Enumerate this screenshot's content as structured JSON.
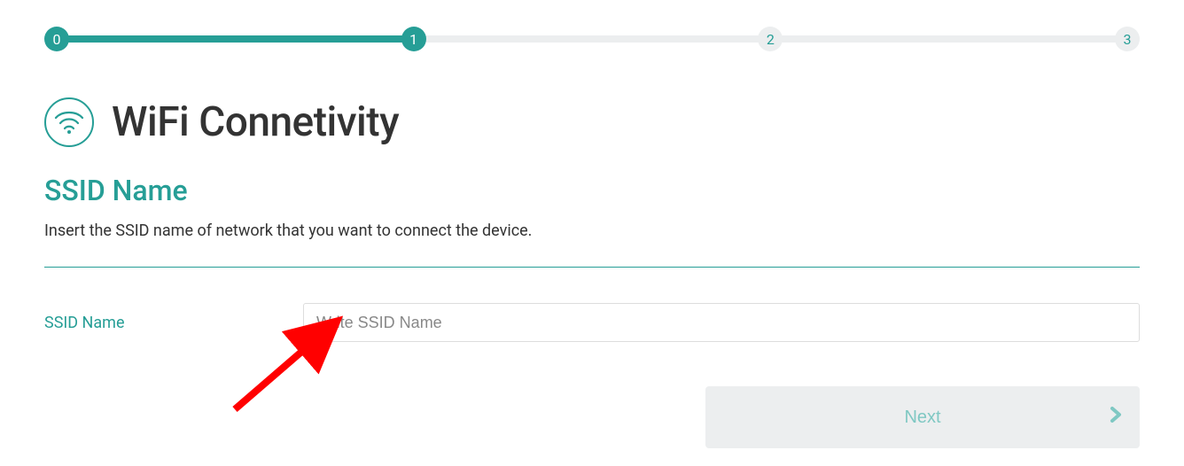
{
  "stepper": {
    "steps": [
      "0",
      "1",
      "2",
      "3"
    ],
    "current_index": 1
  },
  "page": {
    "title": "WiFi Connetivity",
    "section_title": "SSID Name",
    "subtitle": "Insert the SSID name of network that you want to connect the device."
  },
  "form": {
    "ssid_label": "SSID Name",
    "ssid_placeholder": "Write SSID Name",
    "ssid_value": ""
  },
  "buttons": {
    "next": "Next"
  },
  "colors": {
    "primary": "#269e96",
    "muted_bg": "#eceeef",
    "btn_text": "#7fc8c3"
  }
}
